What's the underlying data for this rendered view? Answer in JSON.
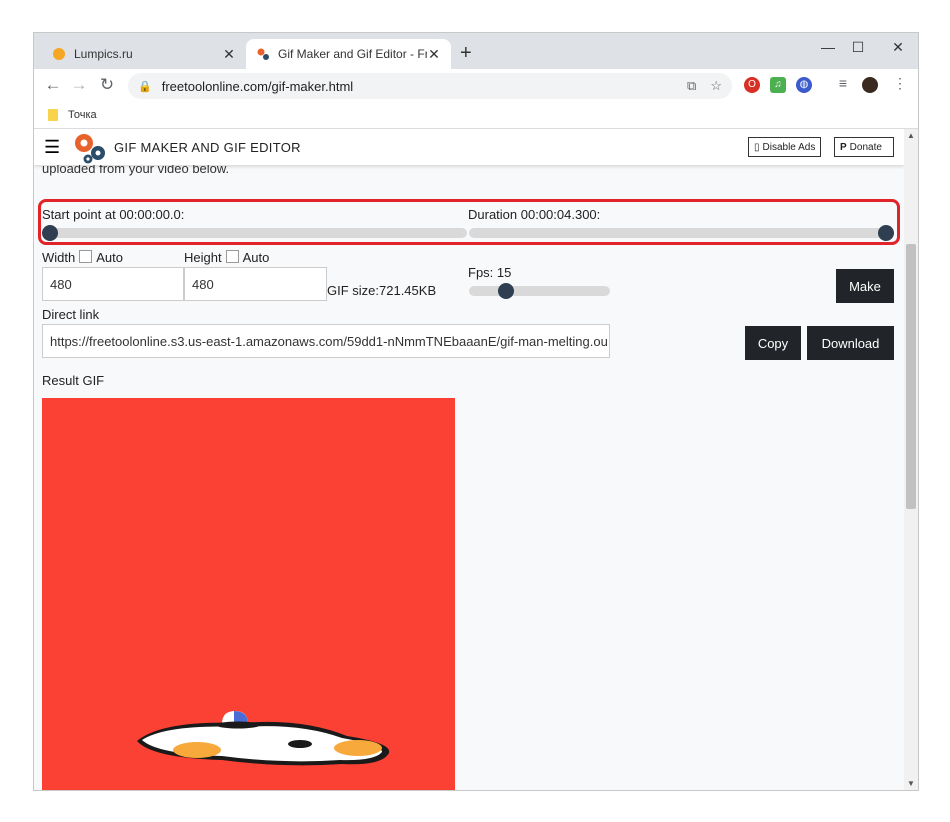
{
  "browser": {
    "tabs": [
      {
        "title": "Lumpics.ru",
        "active": false
      },
      {
        "title": "Gif Maker and Gif Editor - Free To",
        "active": true
      }
    ],
    "new_tab": "+",
    "window_controls": [
      "—",
      "☐",
      "✕"
    ],
    "url": "freetoolonline.com/gif-maker.html",
    "bookmark": "Точка"
  },
  "site": {
    "brand": "GIF MAKER AND GIF EDITOR",
    "disable_ads": "Disable Ads",
    "donate": "Donate",
    "intro_text": "uploaded from your video below.",
    "start_point_label": "Start point at 00:00:00.0:",
    "duration_label": "Duration 00:00:04.300:",
    "width_label": "Width",
    "width_auto": "Auto",
    "width_value": "480",
    "height_label": "Height",
    "height_auto": "Auto",
    "height_value": "480",
    "gif_size": "GIF size:721.45KB",
    "fps_label": "Fps: 15",
    "make_button": "Make",
    "direct_link_label": "Direct link",
    "direct_link_value": "https://freetoolonline.s3.us-east-1.amazonaws.com/59dd1-nNmmTNEbaaanE/gif-man-melting.ou",
    "copy_button": "Copy",
    "download_button": "Download",
    "result_label": "Result GIF"
  },
  "colors": {
    "highlight": "#e0242a",
    "gif_background": "#fb4034",
    "knob": "#2f3e50",
    "dark_button": "#212529"
  }
}
